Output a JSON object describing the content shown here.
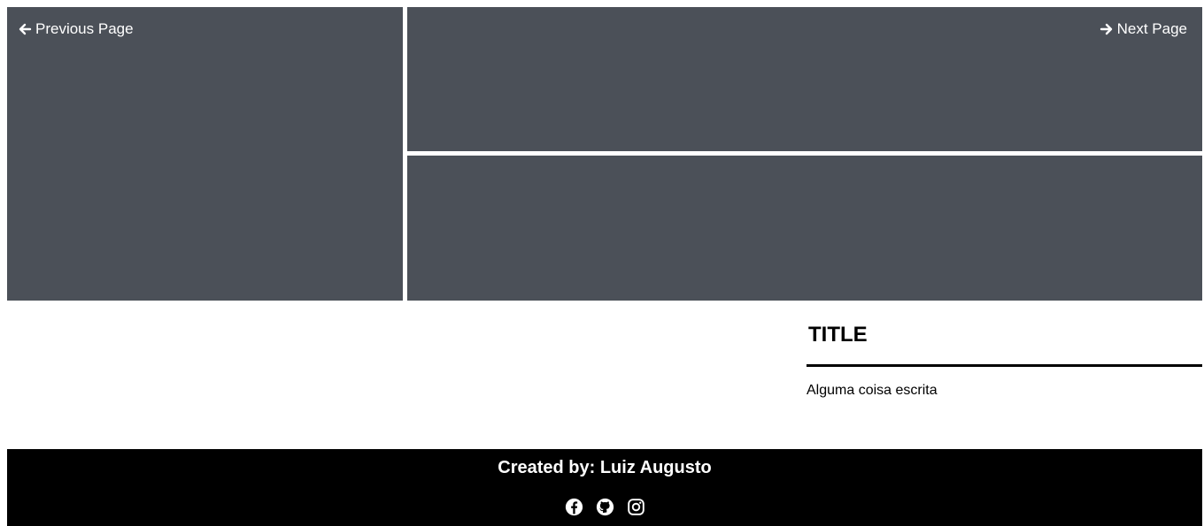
{
  "nav": {
    "previous_label": "Previous Page",
    "next_label": "Next Page",
    "previous_icon": "arrow-left-icon",
    "next_icon": "arrow-right-icon"
  },
  "article": {
    "title": "TITLE",
    "text": "Alguma coisa escrita"
  },
  "footer": {
    "credit": "Created by: Luiz Augusto",
    "social_icons": [
      "facebook-icon",
      "github-icon",
      "instagram-icon"
    ]
  },
  "colors": {
    "panel": "#4b5058",
    "footer_bg": "#000000",
    "page_bg": "#ffffff"
  }
}
